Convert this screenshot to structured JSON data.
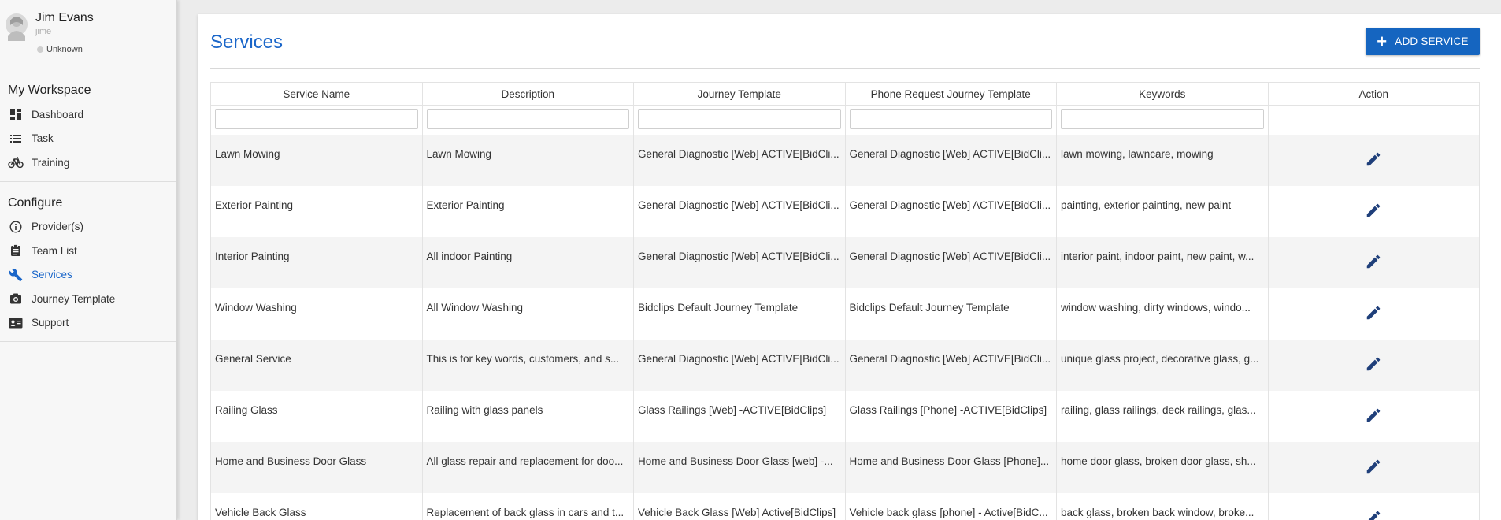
{
  "user": {
    "name": "Jim Evans",
    "username": "jime",
    "status": "Unknown"
  },
  "sidebar": {
    "workspace": {
      "title": "My Workspace",
      "items": [
        {
          "label": "Dashboard",
          "icon": "dashboard-icon"
        },
        {
          "label": "Task",
          "icon": "list-icon"
        },
        {
          "label": "Training",
          "icon": "bicycle-icon"
        }
      ]
    },
    "configure": {
      "title": "Configure",
      "items": [
        {
          "label": "Provider(s)",
          "icon": "info-icon"
        },
        {
          "label": "Team List",
          "icon": "clipboard-icon"
        },
        {
          "label": "Services",
          "icon": "wrench-icon",
          "active": true
        },
        {
          "label": "Journey Template",
          "icon": "camera-icon"
        },
        {
          "label": "Support",
          "icon": "contact-card-icon"
        }
      ]
    }
  },
  "page": {
    "title": "Services",
    "add_button_label": "ADD SERVICE"
  },
  "colors": {
    "accent": "#1a66c9",
    "button": "#1565c0",
    "edit_icon": "#1f3f7a"
  },
  "table": {
    "columns": [
      "Service Name",
      "Description",
      "Journey Template",
      "Phone Request Journey Template",
      "Keywords",
      "Action"
    ],
    "rows": [
      [
        "Lawn Mowing",
        "Lawn Mowing",
        "General Diagnostic [Web] ACTIVE[BidCli...",
        "General Diagnostic [Web] ACTIVE[BidCli...",
        "lawn mowing, lawncare, mowing"
      ],
      [
        "Exterior Painting",
        "Exterior Painting",
        "General Diagnostic [Web] ACTIVE[BidCli...",
        "General Diagnostic [Web] ACTIVE[BidCli...",
        "painting, exterior painting, new paint"
      ],
      [
        "Interior Painting",
        "All indoor Painting",
        "General Diagnostic [Web] ACTIVE[BidCli...",
        "General Diagnostic [Web] ACTIVE[BidCli...",
        "interior paint, indoor paint, new paint, w..."
      ],
      [
        "Window Washing",
        "All Window Washing",
        "Bidclips Default Journey Template",
        "Bidclips Default Journey Template",
        "window washing, dirty windows, windo..."
      ],
      [
        "General Service",
        "This is for key words, customers, and s...",
        "General Diagnostic [Web] ACTIVE[BidCli...",
        "General Diagnostic [Web] ACTIVE[BidCli...",
        "unique glass project, decorative glass, g..."
      ],
      [
        "Railing Glass",
        "Railing with glass panels",
        "Glass Railings [Web] -ACTIVE[BidClips]",
        "Glass Railings [Phone] -ACTIVE[BidClips]",
        "railing, glass railings, deck railings, glas..."
      ],
      [
        "Home and Business Door Glass",
        "All glass repair and replacement for doo...",
        "Home and Business Door Glass [web] -...",
        "Home and Business Door Glass [Phone]...",
        "home door glass, broken door glass, sh..."
      ],
      [
        "Vehicle Back Glass",
        "Replacement of back glass in cars and t...",
        "Vehicle Back Glass [Web] Active[BidClips]",
        "Vehicle back glass [phone] - Active[BidC...",
        "back glass, broken back window, broke..."
      ]
    ]
  }
}
